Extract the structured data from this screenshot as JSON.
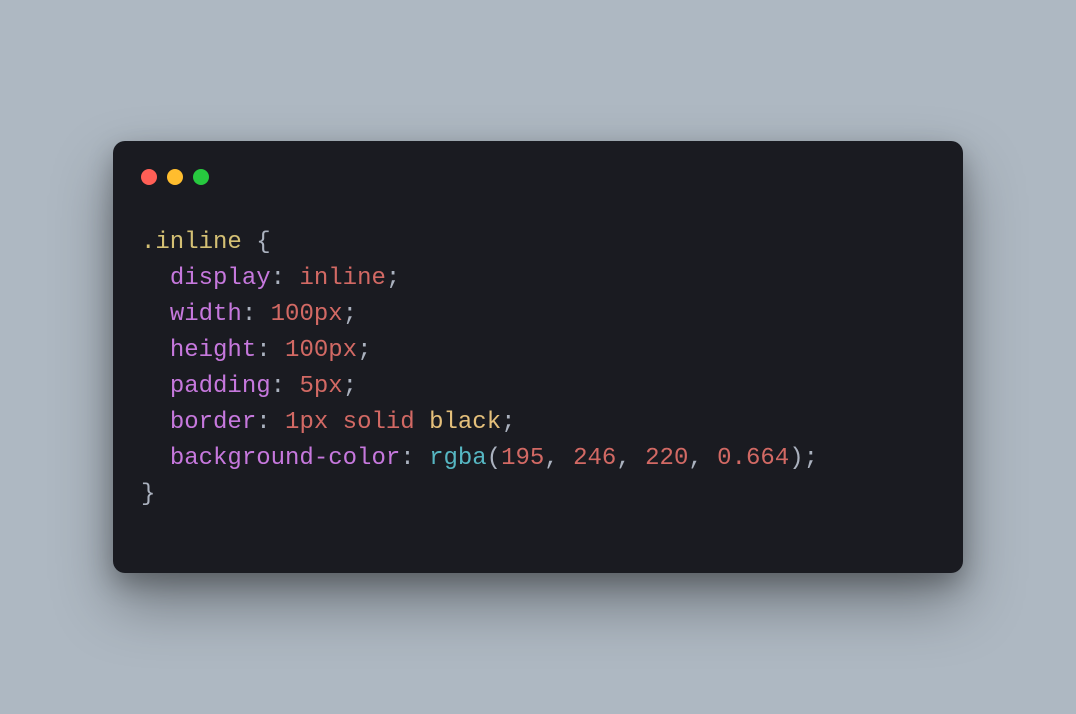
{
  "window": {
    "controls": {
      "close": "close",
      "minimize": "minimize",
      "zoom": "zoom"
    }
  },
  "code": {
    "selector_dot": ".",
    "selector_name": "inline",
    "open_brace": " {",
    "indent": "  ",
    "lines": {
      "display": {
        "prop": "display",
        "colon": ": ",
        "value": "inline",
        "semi": ";"
      },
      "width": {
        "prop": "width",
        "colon": ": ",
        "value": "100px",
        "semi": ";"
      },
      "height": {
        "prop": "height",
        "colon": ": ",
        "value": "100px",
        "semi": ";"
      },
      "padding": {
        "prop": "padding",
        "colon": ": ",
        "value": "5px",
        "semi": ";"
      },
      "border": {
        "prop": "border",
        "colon": ": ",
        "v1": "1px",
        "sp1": " ",
        "v2": "solid",
        "sp2": " ",
        "v3": "black",
        "semi": ";"
      },
      "bgcolor": {
        "prop": "background-color",
        "colon": ": ",
        "func": "rgba",
        "open": "(",
        "a1": "195",
        "c1": ", ",
        "a2": "246",
        "c2": ", ",
        "a3": "220",
        "c3": ", ",
        "a4": "0.664",
        "close": ")",
        "semi": ";"
      }
    },
    "close_brace": "}"
  }
}
